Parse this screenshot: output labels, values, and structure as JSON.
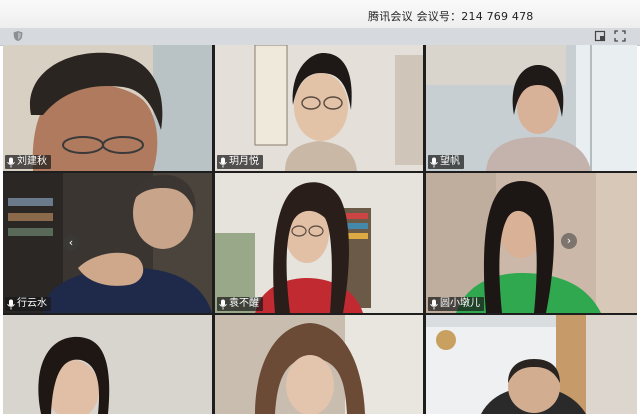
{
  "window": {
    "title": "腾讯会议  会议号：214 769 478"
  },
  "toolbar": {
    "icons": [
      "shield-icon",
      "tile-view-icon",
      "fullscreen-icon"
    ]
  },
  "participants": [
    {
      "name": "刘建秋"
    },
    {
      "name": "玥月悦"
    },
    {
      "name": "望帆"
    },
    {
      "name": "行云水"
    },
    {
      "name": "袁不醒"
    },
    {
      "name": "圆小墩儿"
    }
  ],
  "nav": {
    "prev": "‹",
    "next": "›"
  },
  "colors": {
    "label_bg": "#191919",
    "mic_icon": "#ffffff"
  }
}
